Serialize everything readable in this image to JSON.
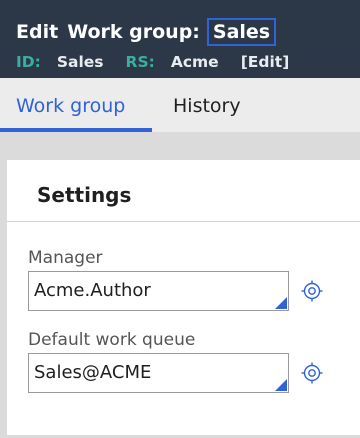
{
  "header": {
    "title_prefix": "Edit",
    "title_class": "Work group:",
    "title_name": "Sales",
    "meta": {
      "id_key": "ID:",
      "id_value": "Sales",
      "rs_key": "RS:",
      "rs_value": "Acme",
      "edit_link": "[Edit]"
    }
  },
  "tabs": [
    {
      "label": "Work group",
      "active": true
    },
    {
      "label": "History",
      "active": false
    }
  ],
  "settings": {
    "title": "Settings",
    "fields": [
      {
        "label": "Manager",
        "value": "Acme.Author",
        "icon": "target-icon"
      },
      {
        "label": "Default work queue",
        "value": "Sales@ACME",
        "icon": "target-icon"
      }
    ]
  },
  "colors": {
    "header_bg": "#2c3747",
    "accent": "#2f63d6",
    "meta_key": "#3aaea0"
  }
}
